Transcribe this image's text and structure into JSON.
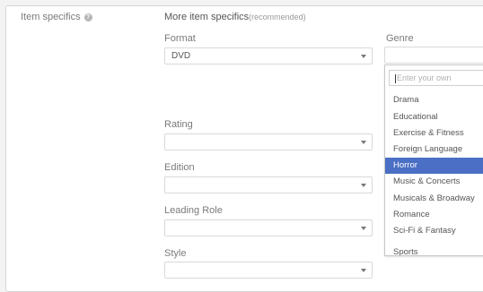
{
  "section": {
    "label": "Item specifics",
    "help_icon": "help-circle-icon"
  },
  "more": {
    "title": "More item specifics",
    "recommended": "(recommended)"
  },
  "fields": {
    "format": {
      "label": "Format",
      "value": "DVD"
    },
    "rating": {
      "label": "Rating",
      "value": ""
    },
    "edition": {
      "label": "Edition",
      "value": ""
    },
    "leading_role": {
      "label": "Leading Role",
      "value": ""
    },
    "style": {
      "label": "Style",
      "value": ""
    }
  },
  "genre": {
    "label": "Genre",
    "entry_placeholder": "Enter your own",
    "options": [
      "Drama",
      "Educational",
      "Exercise & Fitness",
      "Foreign Language",
      "Horror",
      "Music & Concerts",
      "Musicals & Broadway",
      "Romance",
      "Sci-Fi & Fantasy",
      "Sports"
    ],
    "selected": "Horror",
    "highlight_color": "#4a6fc4"
  }
}
